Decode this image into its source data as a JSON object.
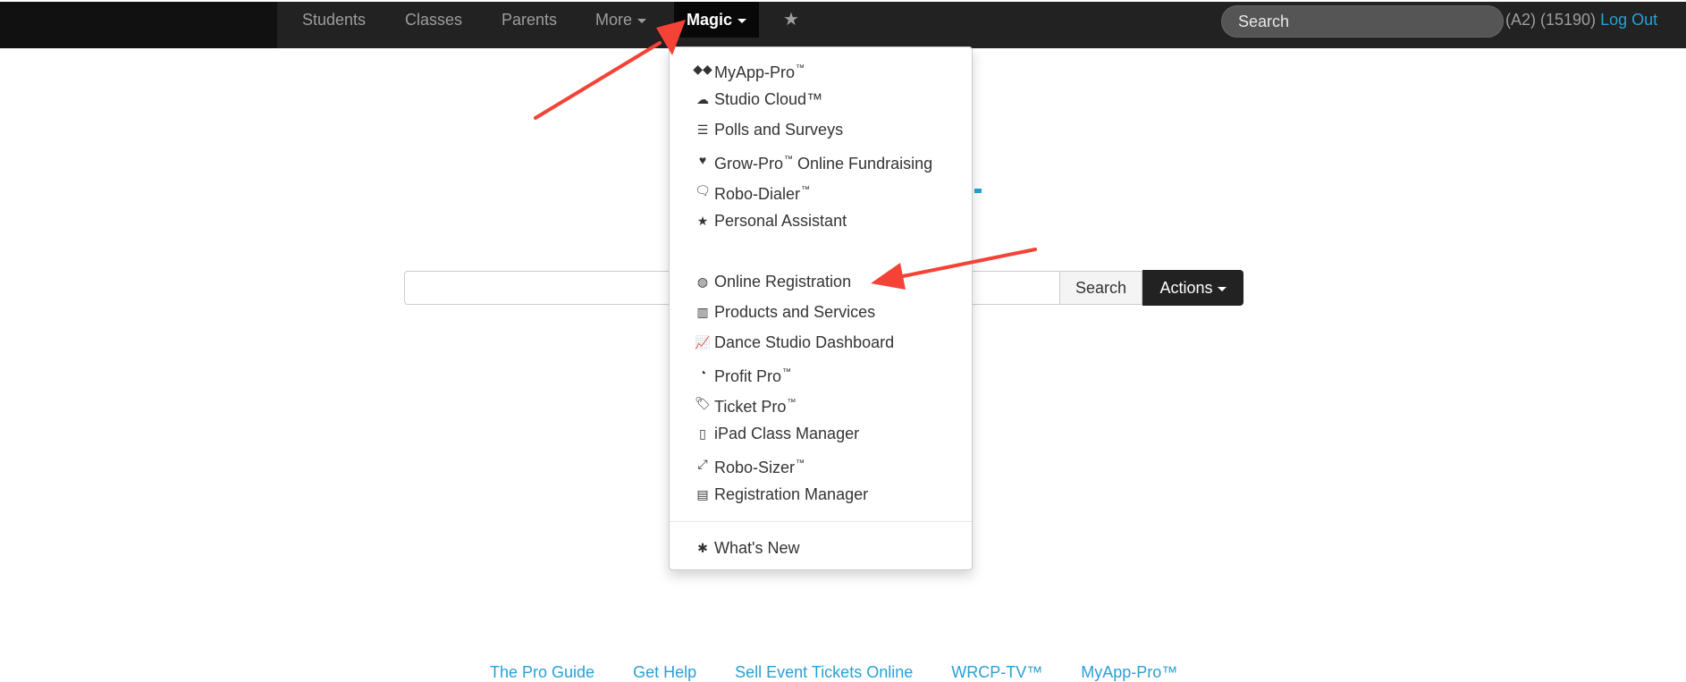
{
  "nav": {
    "items": [
      {
        "label": "Students"
      },
      {
        "label": "Classes"
      },
      {
        "label": "Parents"
      },
      {
        "label": "More"
      }
    ],
    "active_label": "Magic",
    "star_icon": "star-icon",
    "search_placeholder": "Search",
    "account_info": "(A2) (15190)",
    "logout_label": "Log Out"
  },
  "main": {
    "search_button_label": "Search",
    "actions_button_label": "Actions"
  },
  "dropdown": {
    "items": [
      {
        "icon": "apple-android-icon",
        "label": "MyApp-Pro",
        "tm": "™"
      },
      {
        "icon": "cloud-icon",
        "label": "Studio Cloud™",
        "tm": ""
      },
      {
        "icon": "list-icon",
        "label": "Polls and Surveys",
        "tm": ""
      },
      {
        "icon": "heart-icon",
        "label": "Grow-Pro",
        "tm": "™",
        "suffix": " Online Fundraising"
      },
      {
        "icon": "comments-icon",
        "label": "Robo-Dialer",
        "tm": "™"
      },
      {
        "icon": "star-icon",
        "label": "Personal Assistant",
        "tm": ""
      },
      {
        "icon": "globe-icon",
        "label": "Online Registration",
        "tm": ""
      },
      {
        "icon": "barcode-icon",
        "label": "Products and Services",
        "tm": ""
      },
      {
        "icon": "line-chart-icon",
        "label": "Dance Studio Dashboard",
        "tm": ""
      },
      {
        "icon": "pie-chart-icon",
        "label": "Profit Pro",
        "tm": "™"
      },
      {
        "icon": "tags-icon",
        "label": "Ticket Pro",
        "tm": "™"
      },
      {
        "icon": "mobile-icon",
        "label": "iPad Class Manager",
        "tm": ""
      },
      {
        "icon": "expand-icon",
        "label": "Robo-Sizer",
        "tm": "™"
      },
      {
        "icon": "tasks-icon",
        "label": "Registration Manager",
        "tm": ""
      },
      {
        "icon": "asterisk-icon",
        "label": "What's New",
        "tm": ""
      }
    ]
  },
  "footer": {
    "links": [
      "The Pro Guide",
      "Get Help",
      "Sell Event Tickets Online",
      "WRCP-TV™",
      "MyApp-Pro™"
    ]
  },
  "colors": {
    "navbar": "#222222",
    "link": "#2a9fd6",
    "arrow": "#f44336"
  }
}
